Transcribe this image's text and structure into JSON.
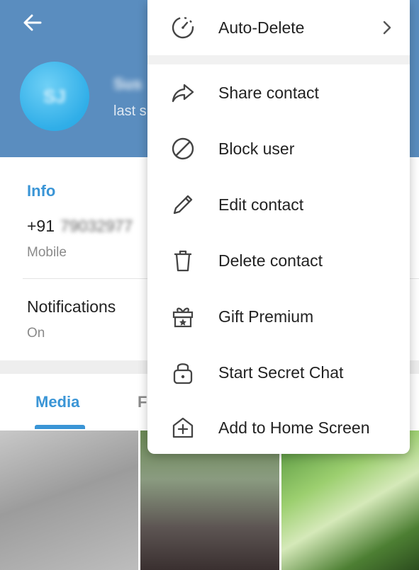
{
  "profile": {
    "avatar_initials": "SJ",
    "name": "Sus",
    "status": "last s"
  },
  "info": {
    "section_title": "Info",
    "phone_prefix": "+91",
    "phone_number": "79032977",
    "phone_label": "Mobile",
    "notifications_title": "Notifications",
    "notifications_value": "On"
  },
  "tabs": {
    "media_label": "Media",
    "files_label": "F"
  },
  "menu": {
    "auto_delete": "Auto-Delete",
    "items": [
      {
        "label": "Share contact"
      },
      {
        "label": "Block user"
      },
      {
        "label": "Edit contact"
      },
      {
        "label": "Delete contact"
      },
      {
        "label": "Gift Premium"
      },
      {
        "label": "Start Secret Chat"
      },
      {
        "label": "Add to Home Screen"
      }
    ]
  },
  "colors": {
    "header": "#5a8dbf",
    "accent": "#3a95d6",
    "icon": "#444444"
  }
}
